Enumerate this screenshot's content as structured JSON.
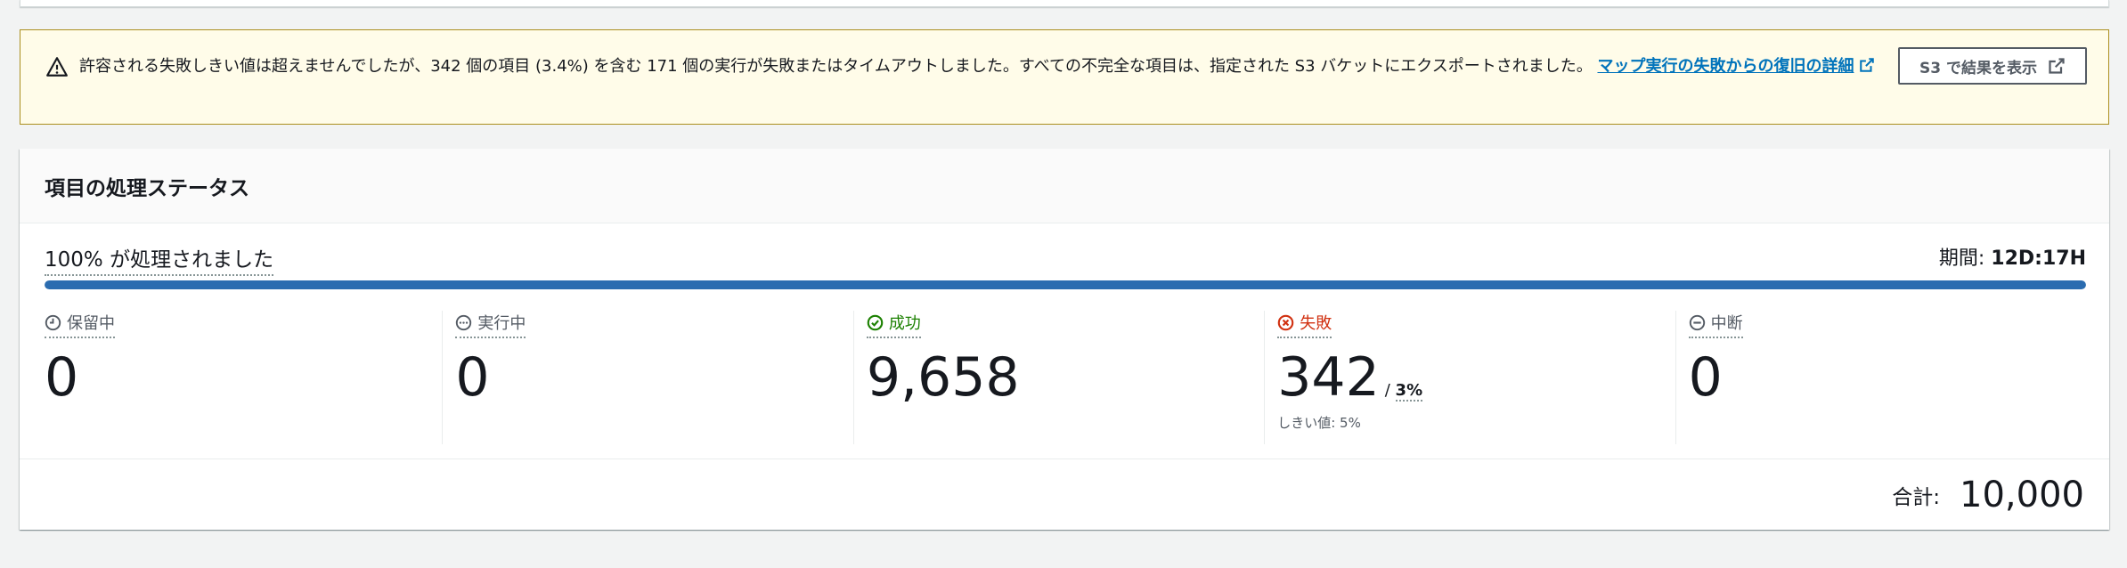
{
  "alert": {
    "message": "許容される失敗しきい値は超えませんでしたが、342 個の項目 (3.4%) を含む 171 個の実行が失敗またはタイムアウトしました。すべての不完全な項目は、指定された S3 バケットにエクスポートされました。",
    "link_text": "マップ実行の失敗からの復旧の詳細",
    "button_label": "S3 で結果を表示",
    "color": "#ab8f1e"
  },
  "panel": {
    "title": "項目の処理ステータス",
    "progress_label": "100% が処理されました",
    "progress_percent": 100,
    "duration_label": "期間: ",
    "duration_value": "12D:17H",
    "bar_color": "#2b6cb0"
  },
  "stats": [
    {
      "label": "保留中",
      "value": "0",
      "icon": "clock-icon"
    },
    {
      "label": "実行中",
      "value": "0",
      "icon": "in-progress-icon"
    },
    {
      "label": "成功",
      "value": "9,658",
      "icon": "check-circle-icon",
      "color": "#1d8102"
    },
    {
      "label": "失敗",
      "value": "342",
      "percent": "/ ",
      "percent_value": "3%",
      "threshold": "しきい値: 5%",
      "icon": "error-circle-icon",
      "color": "#d13212"
    },
    {
      "label": "中断",
      "value": "0",
      "icon": "stopped-icon"
    }
  ],
  "footer": {
    "total_label": "合計:",
    "total_value": "10,000"
  }
}
